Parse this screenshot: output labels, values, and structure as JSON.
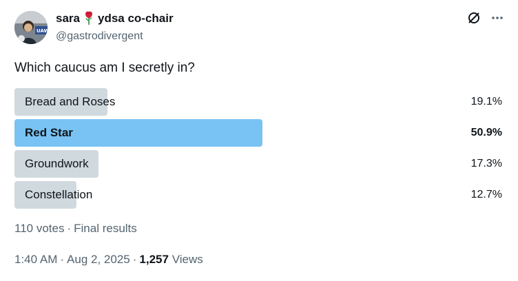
{
  "author": {
    "name_start": "sara",
    "name_end": "ydsa co-chair",
    "handle": "@gastrodivergent",
    "emoji_icon": "rose-icon"
  },
  "actions": {
    "grok_icon": "slashed-circle-icon",
    "more_icon": "more-icon"
  },
  "tweet": {
    "text": "Which caucus am I secretly in?"
  },
  "poll": {
    "options": [
      {
        "label": "Bread and Roses",
        "percent_text": "19.1%",
        "percent": 19.1,
        "winner": false
      },
      {
        "label": "Red Star",
        "percent_text": "50.9%",
        "percent": 50.9,
        "winner": true
      },
      {
        "label": "Groundwork",
        "percent_text": "17.3%",
        "percent": 17.3,
        "winner": false
      },
      {
        "label": "Constellation",
        "percent_text": "12.7%",
        "percent": 12.7,
        "winner": false
      }
    ],
    "votes_text": "110 votes",
    "dot": "·",
    "status_text": "Final results"
  },
  "timestamp": {
    "time": "1:40 AM",
    "dot": "·",
    "date": "Aug 2, 2025",
    "views_count": "1,257",
    "views_label": "Views"
  },
  "colors": {
    "bar": "#cfd9de",
    "winner_bar": "#78c3f3",
    "secondary_text": "#536471",
    "primary_text": "#0f1419"
  }
}
